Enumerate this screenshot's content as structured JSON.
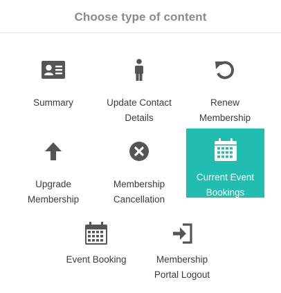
{
  "dialog": {
    "title": "Choose type of content"
  },
  "colors": {
    "accent": "#20bdb0",
    "icon": "#555555",
    "title": "#8a8a8a"
  },
  "tiles": [
    {
      "label": "Summary",
      "icon": "id-card-icon",
      "selected": false
    },
    {
      "label": "Update Contact\nDetails",
      "icon": "person-icon",
      "selected": false
    },
    {
      "label": "Renew\nMembership",
      "icon": "renew-icon",
      "selected": false
    },
    {
      "label": "Upgrade\nMembership",
      "icon": "arrow-up-icon",
      "selected": false
    },
    {
      "label": "Membership\nCancellation",
      "icon": "cancel-icon",
      "selected": false
    },
    {
      "label": "Current Event\nBookings",
      "icon": "calendar-icon",
      "selected": true
    },
    {
      "label": "Event Booking",
      "icon": "calendar-icon",
      "selected": false
    },
    {
      "label": "Membership\nPortal Logout",
      "icon": "logout-icon",
      "selected": false
    }
  ]
}
